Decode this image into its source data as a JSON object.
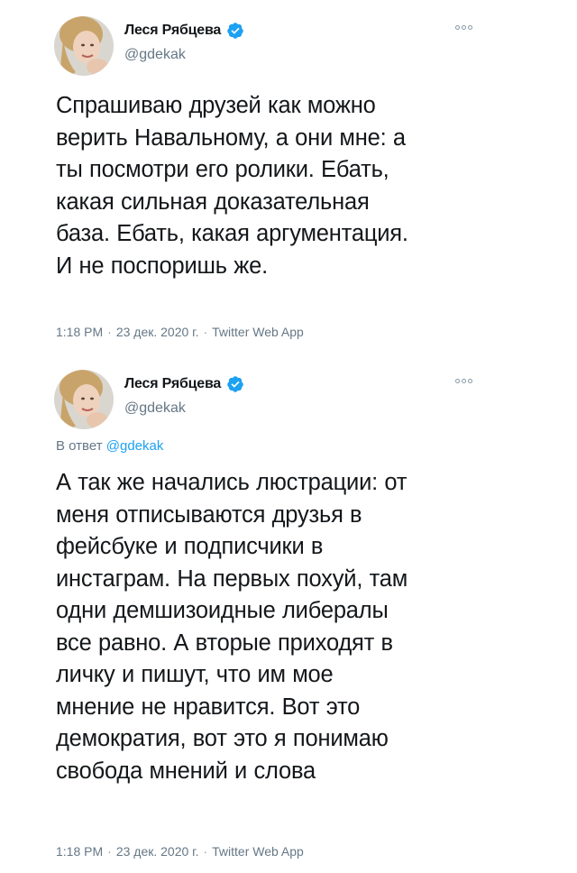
{
  "tweets": [
    {
      "author": {
        "name": "Леся Рябцева",
        "handle": "@gdekak"
      },
      "reply_label": "",
      "reply_handle": "",
      "body_lines": [
        "Спрашиваю друзей как можно",
        "верить Навальному, а они мне: а",
        "ты посмотри его ролики. Ебать,",
        "какая сильная доказательная",
        "база. Ебать, какая аргументация.",
        "И не поспоришь же."
      ],
      "time": "1:18 PM",
      "date": "23 дек. 2020 г.",
      "source": "Twitter Web App"
    },
    {
      "author": {
        "name": "Леся Рябцева",
        "handle": "@gdekak"
      },
      "reply_label": "В ответ",
      "reply_handle": "@gdekak",
      "body_lines": [
        "А так же начались люстрации: от",
        "меня отписываются друзья в",
        "фейсбуке и подписчики в",
        "инстаграм. На первых похуй, там",
        "одни демшизоидные либералы",
        "все равно. А вторые приходят в",
        "личку и пишут, что им мое",
        "мнение не нравится. Вот это",
        "демократия, вот это я понимаю",
        "свобода мнений и слова"
      ],
      "time": "1:18 PM",
      "date": "23 дек. 2020 г.",
      "source": "Twitter Web App"
    }
  ],
  "icons": {
    "verified": "verified-badge-icon",
    "more": "more-options-icon"
  },
  "colors": {
    "text": "#14171a",
    "secondary": "#657786",
    "link": "#1da1f2",
    "verified": "#1da1f2"
  }
}
